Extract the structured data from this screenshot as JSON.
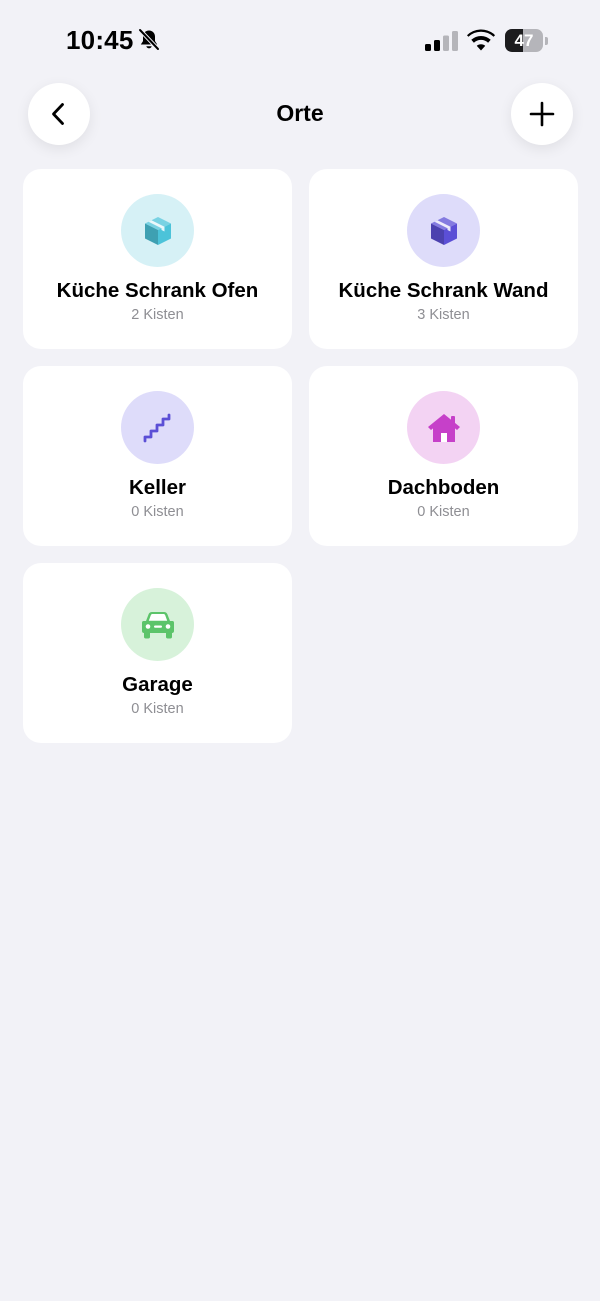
{
  "status_bar": {
    "time": "10:45",
    "battery_level": "47",
    "battery_fraction": 0.47
  },
  "nav": {
    "title": "Orte",
    "back_icon": "chevron-left-icon",
    "add_icon": "plus-icon"
  },
  "places": [
    {
      "name": "Küche Schrank Ofen",
      "count": "2 Kisten",
      "icon": "box-icon",
      "icon_color": "#4cc3d9",
      "circle_color": "#d6f1f6"
    },
    {
      "name": "Küche Schrank Wand",
      "count": "3 Kisten",
      "icon": "box-icon",
      "icon_color": "#5b4fd6",
      "circle_color": "#dedcfa"
    },
    {
      "name": "Keller",
      "count": "0 Kisten",
      "icon": "stairs-icon",
      "icon_color": "#5b4fd6",
      "circle_color": "#dedcfa"
    },
    {
      "name": "Dachboden",
      "count": "0 Kisten",
      "icon": "house-icon",
      "icon_color": "#c640c9",
      "circle_color": "#f3d3f3"
    },
    {
      "name": "Garage",
      "count": "0 Kisten",
      "icon": "car-icon",
      "icon_color": "#5cc46a",
      "circle_color": "#d7f2da"
    }
  ]
}
